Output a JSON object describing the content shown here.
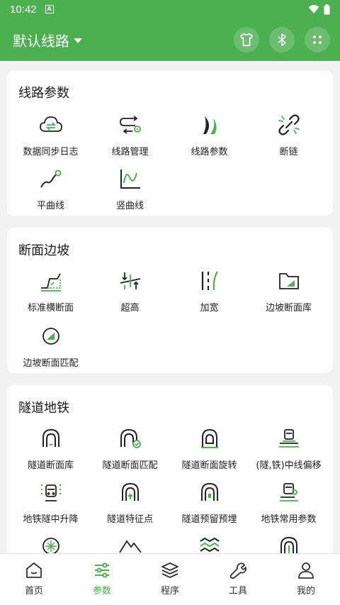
{
  "status": {
    "time": "10:42"
  },
  "app": {
    "title": "默认线路"
  },
  "sections": [
    {
      "title": "线路参数",
      "items": [
        "数据同步日志",
        "线路管理",
        "线路参数",
        "断链",
        "平曲线",
        "竖曲线"
      ]
    },
    {
      "title": "断面边坡",
      "items": [
        "标准横断面",
        "超高",
        "加宽",
        "边坡断面库",
        "边坡断面匹配"
      ]
    },
    {
      "title": "隧道地铁",
      "items": [
        "隧道断面库",
        "隧道断面匹配",
        "隧道断面旋转",
        "(隧,铁)中线偏移",
        "地铁隧中升降",
        "隧道特征点",
        "隧道预留预埋",
        "地铁常用参数"
      ]
    }
  ],
  "nav": [
    {
      "label": "首页",
      "icon": "home-icon"
    },
    {
      "label": "参数",
      "icon": "sliders-icon"
    },
    {
      "label": "程序",
      "icon": "layers-icon"
    },
    {
      "label": "工具",
      "icon": "wrench-icon"
    },
    {
      "label": "我的",
      "icon": "person-icon"
    }
  ],
  "colors": {
    "accent": "#4caf50",
    "icon": "#222222"
  }
}
